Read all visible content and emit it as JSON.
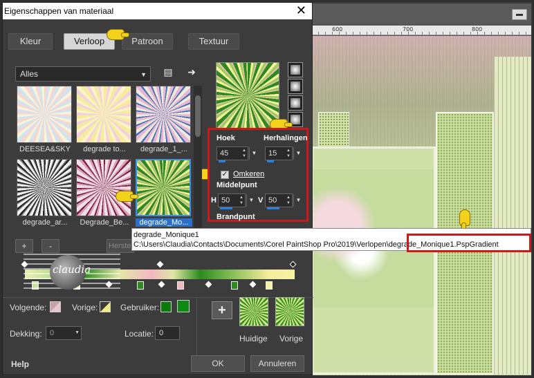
{
  "dialog": {
    "title": "Eigenschappen van materiaal",
    "close": "✕",
    "tabs": [
      "Kleur",
      "Verloop",
      "Patroon",
      "Textuur"
    ],
    "active_tab": "Verloop",
    "category": "Alles",
    "thumbs": [
      {
        "label": "DEESEA&SKY"
      },
      {
        "label": "degrade to..."
      },
      {
        "label": "degrade_1_..."
      },
      {
        "label": "degrade_ar..."
      },
      {
        "label": "Degrade_Be..."
      },
      {
        "label": "degrade_Mo..."
      }
    ],
    "params": {
      "hoek_label": "Hoek",
      "hoek_value": "45",
      "herhalingen_label": "Herhalingen",
      "herhalingen_value": "15",
      "omkeren_label": "Omkeren",
      "middelpunt_label": "Middelpunt",
      "h_label": "H",
      "h_value": "50",
      "v_label": "V",
      "v_value": "50",
      "brandpunt_label": "Brandpunt"
    },
    "tooltip": {
      "line1": "degrade_Monique1",
      "line2": "C:\\Users\\Claudia\\Contacts\\Documents\\Corel PaintShop Pro\\2019\\Verlopen\\degrade_Monique1.PspGradient"
    },
    "small_buttons": {
      "plus": "+",
      "minus": "-",
      "herstel": "Herste"
    },
    "logo_text": "claudia",
    "colors": {
      "volgende_label": "Volgende:",
      "vorige_label": "Vorige:",
      "gebruiker_label": "Gebruiker:",
      "user_color_1": "#0a7a0a",
      "user_color_2": "#0e8a14"
    },
    "swatches": {
      "huidige": "Huidige",
      "vorige": "Vorige"
    },
    "dekking_label": "Dekking:",
    "dekking_value": "0",
    "locatie_label": "Locatie:",
    "locatie_value": "0",
    "help": "Help",
    "ok": "OK",
    "annuleren": "Annuleren"
  },
  "workspace": {
    "ruler_labels": [
      "600",
      "700",
      "800"
    ]
  }
}
